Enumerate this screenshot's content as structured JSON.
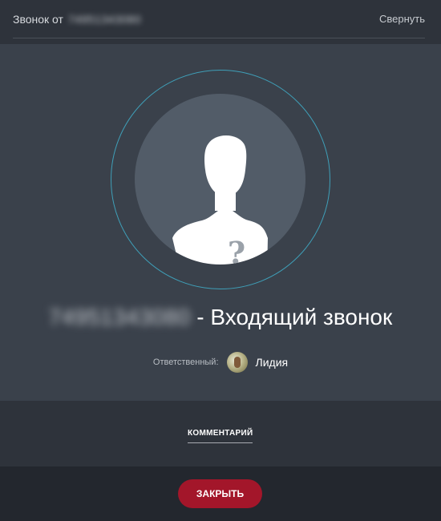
{
  "header": {
    "title_prefix": "Звонок от",
    "caller_number": "74951343080",
    "collapse_label": "Свернуть"
  },
  "call": {
    "caller_number": "74951343080",
    "status_text": "- Входящий звонок",
    "avatar_icon": "unknown-person-icon",
    "responsible_label": "Ответственный:",
    "responsible_name": "Лидия"
  },
  "comments": {
    "tab_label": "КОММЕНТАРИЙ"
  },
  "footer": {
    "close_label": "ЗАКРЫТЬ"
  },
  "colors": {
    "accent_ring": "#3f9fb8",
    "close_button": "#a3162a",
    "panel": "#3a414b"
  }
}
